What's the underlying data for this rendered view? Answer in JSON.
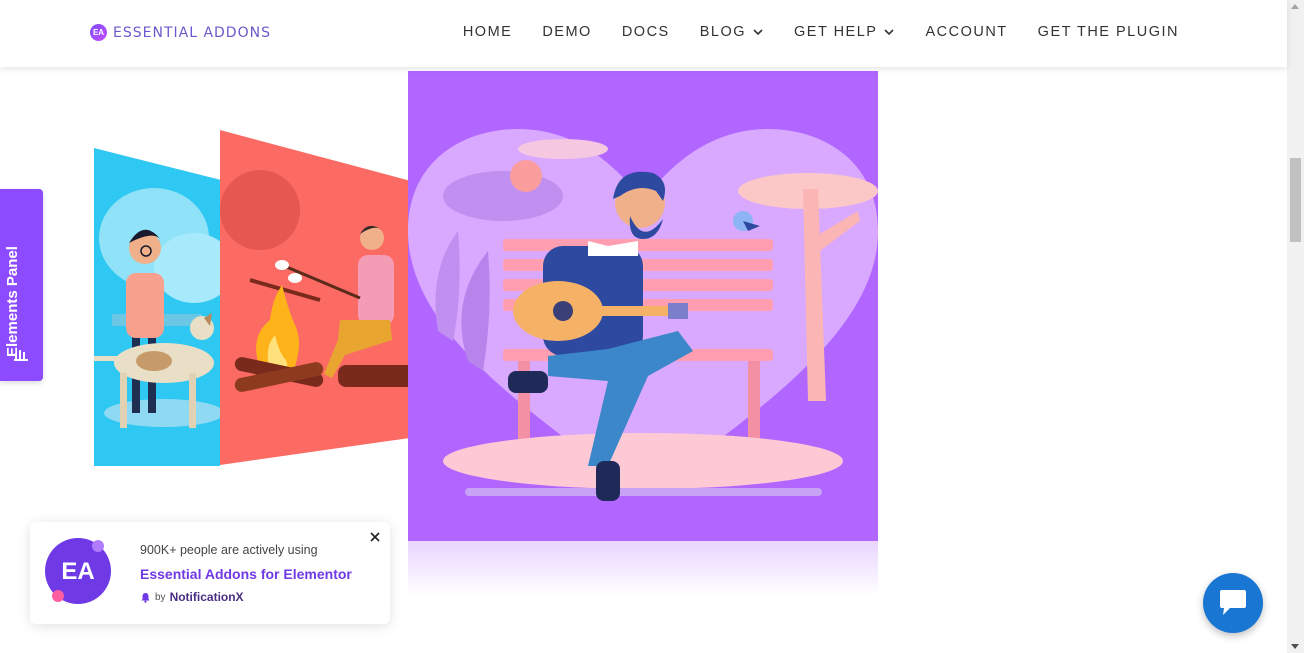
{
  "header": {
    "logo_badge": "EA",
    "logo_text": "ESSENTIAL ADDONS",
    "nav": {
      "home": "HOME",
      "demo": "DEMO",
      "docs": "DOCS",
      "blog": "BLOG",
      "get_help": "GET HELP",
      "account": "ACCOUNT",
      "get_plugin": "GET THE PLUGIN"
    }
  },
  "side_panel": {
    "label": "Elements Panel",
    "icon": "bar-chart-icon"
  },
  "notification": {
    "line1": "900K+ people are actively using",
    "line2": "Essential Addons for Elementor",
    "by": "by",
    "brand": "NotificationX"
  },
  "colors": {
    "accent": "#8c4bff",
    "panel_blue": "#2ec8f2",
    "panel_red": "#fb6a63",
    "panel_purple": "#b066ff",
    "chat": "#1976d2"
  },
  "icons": {
    "chat": "chat-bubble-icon",
    "close": "close-icon",
    "chevron": "chevron-down-icon"
  }
}
